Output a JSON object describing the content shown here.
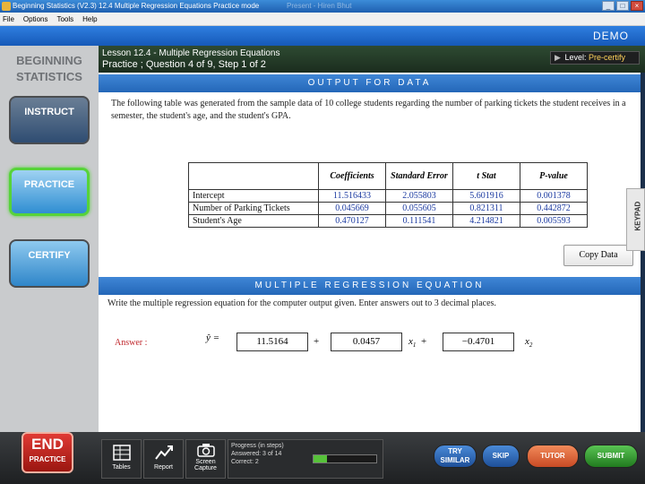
{
  "window": {
    "title": "Beginning Statistics (V2.3)   12.4 Multiple Regression Equations   Practice mode",
    "faint_title": "Present - Hiren Bhut",
    "controls": [
      "_",
      "□",
      "×"
    ]
  },
  "menu": [
    "File",
    "Options",
    "Tools",
    "Help"
  ],
  "banner": {
    "demo": "DEMO"
  },
  "sidebar": {
    "brand_line1": "BEGINNING",
    "brand_line2": "STATISTICS",
    "instruct": "INSTRUCT",
    "practice": "PRACTICE",
    "certify": "CERTIFY"
  },
  "lesson": {
    "line1": "Lesson 12.4 - Multiple Regression Equations",
    "line2": "Practice ; Question 4 of 9, Step 1 of 2",
    "level_label": "Level:",
    "level_value": "Pre-certify"
  },
  "output": {
    "header": "OUTPUT FOR DATA",
    "intro": "The following table was generated from the sample data of 10 college students regarding the number of parking tickets the student receives in a semester, the student's age, and the student's GPA.",
    "columns": [
      "Coefficients",
      "Standard Error",
      "t Stat",
      "P-value"
    ],
    "rows": [
      {
        "label": "Intercept",
        "values": [
          "11.516433",
          "2.055803",
          "5.601916",
          "0.001378"
        ]
      },
      {
        "label": "Number of Parking Tickets",
        "values": [
          "0.045669",
          "0.055605",
          "0.821311",
          "0.442872"
        ]
      },
      {
        "label": "Student's Age",
        "values": [
          "0.470127",
          "0.111541",
          "4.214821",
          "0.005593"
        ]
      }
    ],
    "copy_button": "Copy Data"
  },
  "equation": {
    "header": "MULTIPLE REGRESSION EQUATION",
    "prompt": "Write the multiple regression equation for the computer output given.  Enter answers out to 3 decimal places.",
    "answer_label": "Answer :",
    "yhat": "ŷ =",
    "inputs": [
      "11.5164",
      "0.0457",
      "−0.4701"
    ],
    "plus": "+",
    "x1": "x",
    "x1_sub": "1",
    "x2": "x",
    "x2_sub": "2"
  },
  "keypad": "KEYPAD",
  "toolbar": {
    "end": "END",
    "end_sub": "PRACTICE",
    "tables": "Tables",
    "report": "Report",
    "screen_capture_1": "Screen",
    "screen_capture_2": "Capture",
    "progress_title": "Progress (in steps)",
    "answered": "Answered:   3   of  14",
    "correct": "Correct:     2",
    "progress_fraction": 0.214,
    "try_similar_1": "TRY",
    "try_similar_2": "SIMILAR",
    "skip": "SKIP",
    "tutor": "TUTOR",
    "submit": "SUBMIT"
  }
}
